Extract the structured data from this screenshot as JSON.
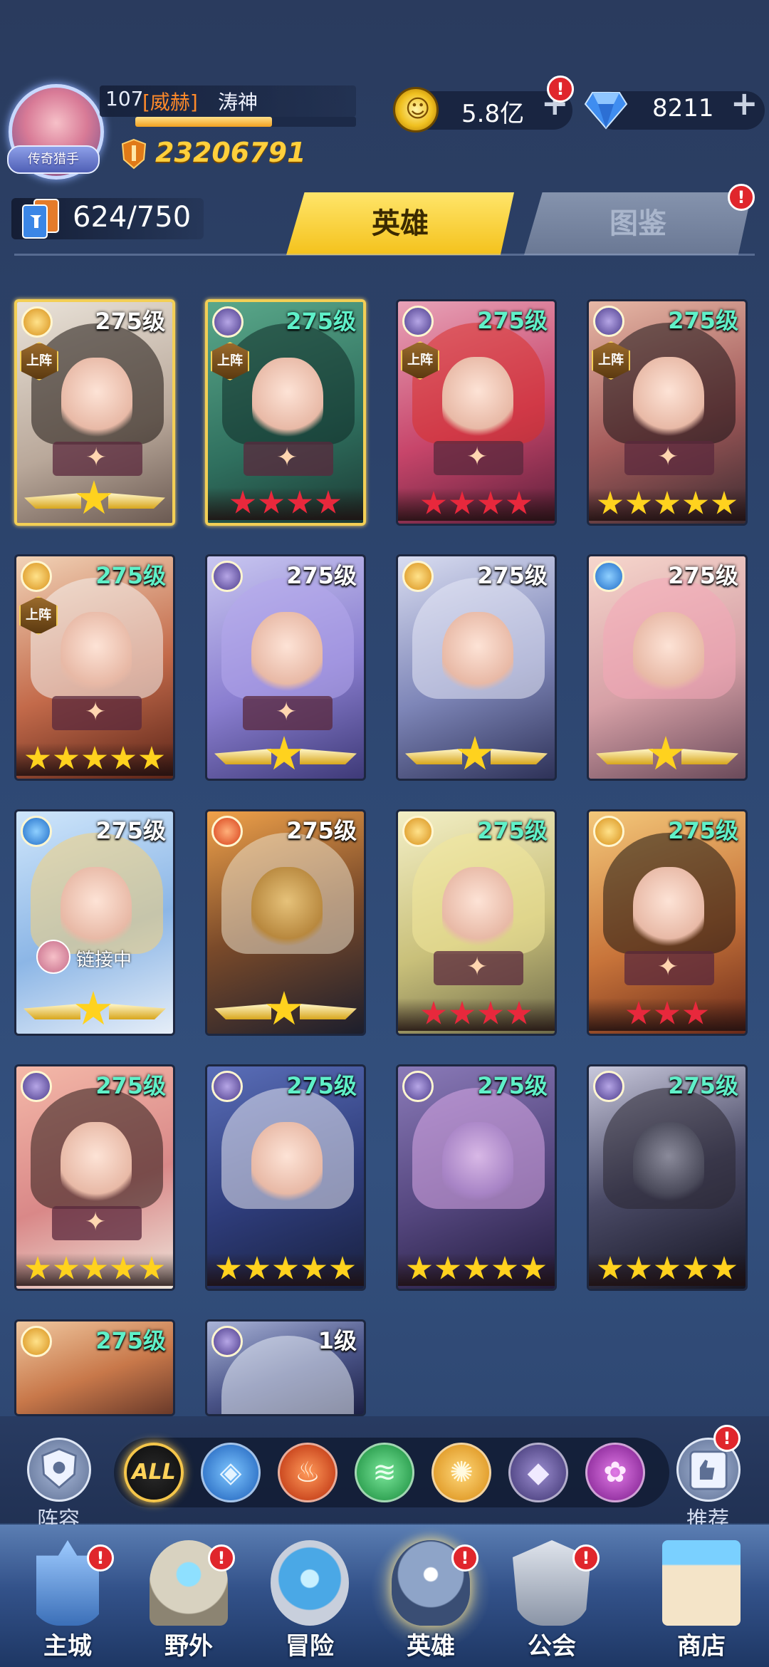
{
  "player": {
    "level": "107",
    "guild": "[威赫]",
    "name": "涛神",
    "badge": "传奇猎手",
    "power": "23206791"
  },
  "currency": {
    "gold": "5.8亿",
    "diamonds": "8211",
    "plus": "+",
    "alert": "!"
  },
  "collection": {
    "count": "624/750"
  },
  "tabs": {
    "heroes": "英雄",
    "guide": "图鉴"
  },
  "hero_grid": {
    "deploy_label": "上阵",
    "linking_label": "链接中",
    "heroes": [
      {
        "level": "275级"
      },
      {
        "level": "275级"
      },
      {
        "level": "275级"
      },
      {
        "level": "275级"
      },
      {
        "level": "275级"
      },
      {
        "level": "275级"
      },
      {
        "level": "275级"
      },
      {
        "level": "275级"
      },
      {
        "level": "275级"
      },
      {
        "level": "275级"
      },
      {
        "level": "275级"
      },
      {
        "level": "275级"
      },
      {
        "level": "275级"
      },
      {
        "level": "275级"
      },
      {
        "level": "275级"
      },
      {
        "level": "275级"
      },
      {
        "level": "275级"
      },
      {
        "level": "1级"
      }
    ]
  },
  "filters": {
    "lineup": "阵容",
    "recommend": "推荐",
    "all": "ALL",
    "elements": [
      "water",
      "fire",
      "wind",
      "light",
      "dark",
      "arcane"
    ]
  },
  "nav": {
    "items": [
      "主城",
      "野外",
      "冒险",
      "英雄",
      "公会",
      "商店"
    ],
    "active": "英雄"
  },
  "colors": {
    "accent_gold": "#f4c21c",
    "level_green": "#5ff0c8",
    "alert_red": "#e0262c"
  }
}
